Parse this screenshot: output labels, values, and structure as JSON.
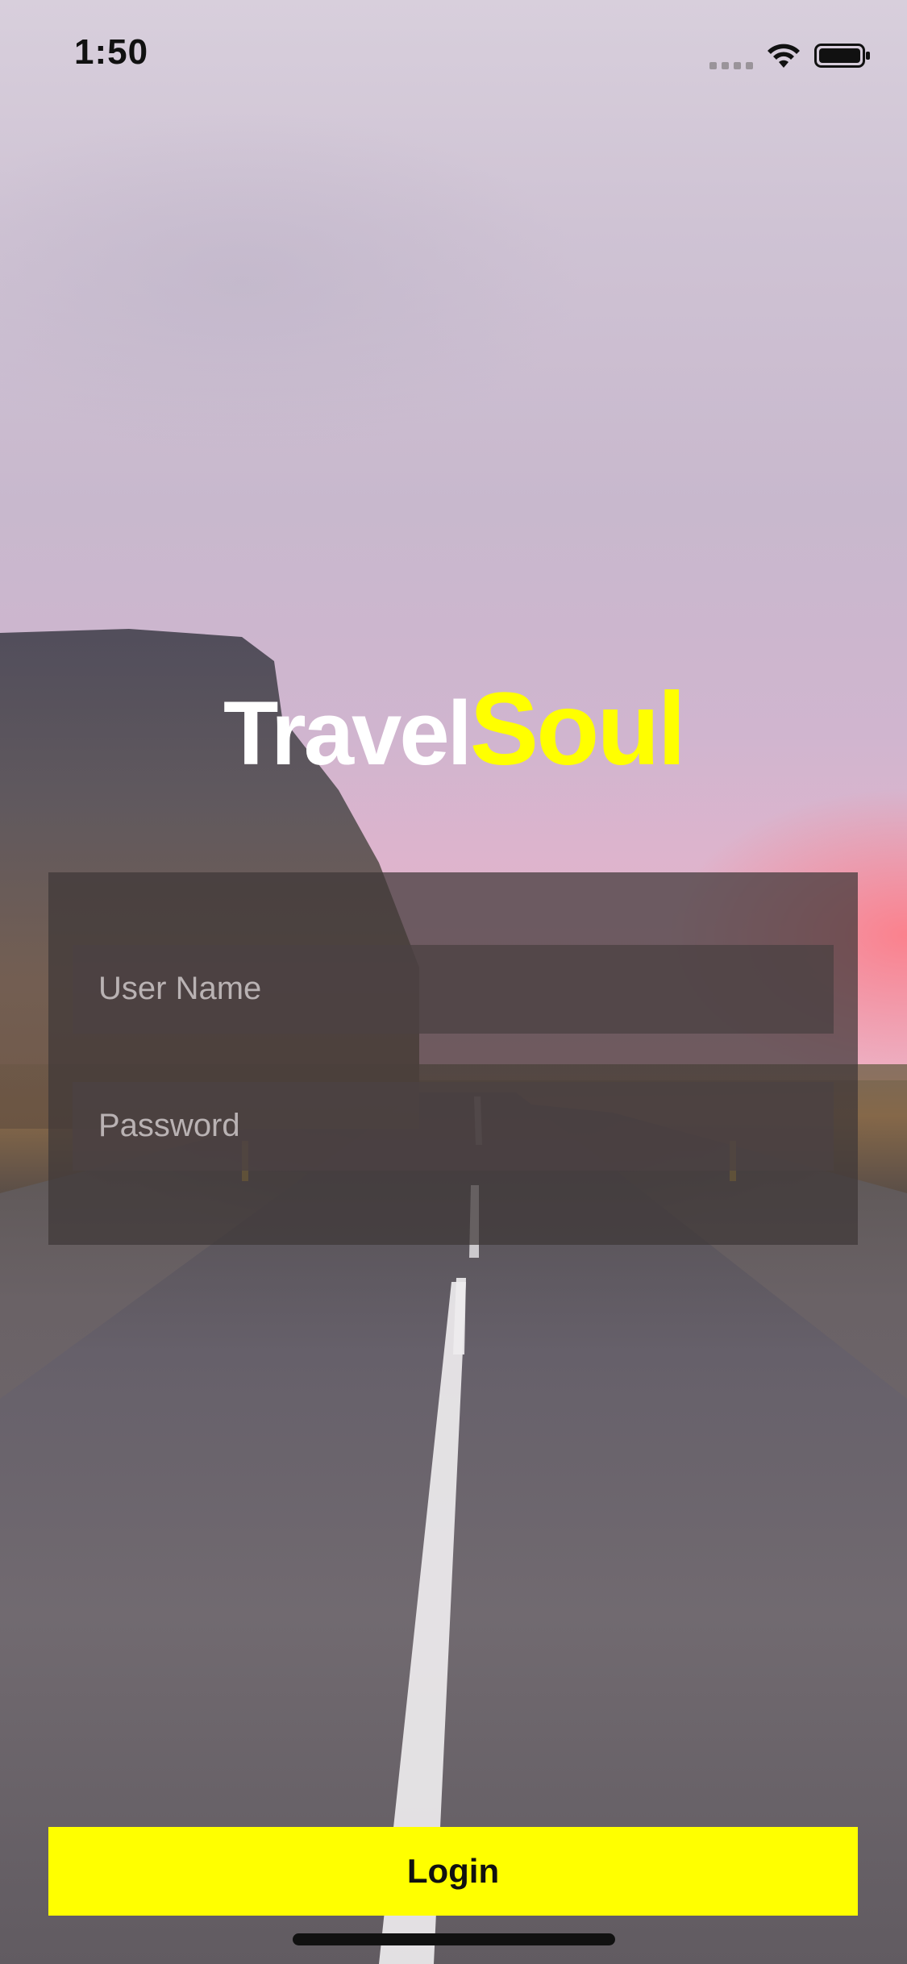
{
  "status_bar": {
    "time": "1:50",
    "icons": [
      "signal-icon",
      "wifi-icon",
      "battery-icon"
    ]
  },
  "brand": {
    "part1": "Travel",
    "part2": "Soul",
    "colors": {
      "part1": "#ffffff",
      "part2": "#ffff00"
    }
  },
  "login_form": {
    "username_placeholder": "User Name",
    "password_placeholder": "Password"
  },
  "actions": {
    "login_label": "Login",
    "login_color": "#ffff00"
  }
}
